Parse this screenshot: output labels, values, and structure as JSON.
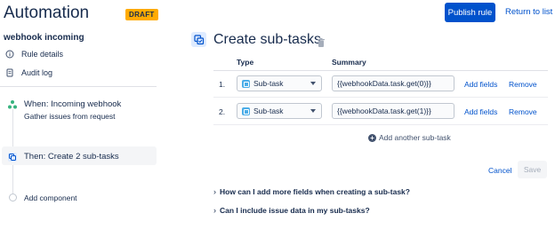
{
  "header": {
    "title": "Automation",
    "badge": "DRAFT",
    "publish_label": "Publish rule",
    "return_label": "Return to list"
  },
  "sidebar": {
    "rule_name": "webhook incoming",
    "items": [
      {
        "label": "Rule details",
        "icon": "info-icon"
      },
      {
        "label": "Audit log",
        "icon": "document-icon"
      }
    ],
    "trigger": {
      "title": "When: Incoming webhook",
      "subtitle": "Gather issues from request",
      "icon": "webhook-icon"
    },
    "action": {
      "title": "Then: Create 2 sub-tasks",
      "icon": "subtask-icon"
    },
    "add_component": "Add component"
  },
  "panel": {
    "title": "Create sub-tasks",
    "columns": {
      "type": "Type",
      "summary": "Summary"
    },
    "rows": [
      {
        "num": "1.",
        "type": "Sub-task",
        "summary": "{{webhookData.task.get(0)}}",
        "add_fields": "Add fields",
        "remove": "Remove"
      },
      {
        "num": "2.",
        "type": "Sub-task",
        "summary": "{{webhookData.task.get(1)}}",
        "add_fields": "Add fields",
        "remove": "Remove"
      }
    ],
    "add_another": "Add another sub-task",
    "cancel_label": "Cancel",
    "save_label": "Save",
    "faqs": [
      "How can I add more fields when creating a sub-task?",
      "Can I include issue data in my sub-tasks?"
    ]
  },
  "colors": {
    "brand": "#0052cc",
    "badge": "#ffab00",
    "subtask": "#4bade8",
    "trigger_green": "#36b37e"
  }
}
